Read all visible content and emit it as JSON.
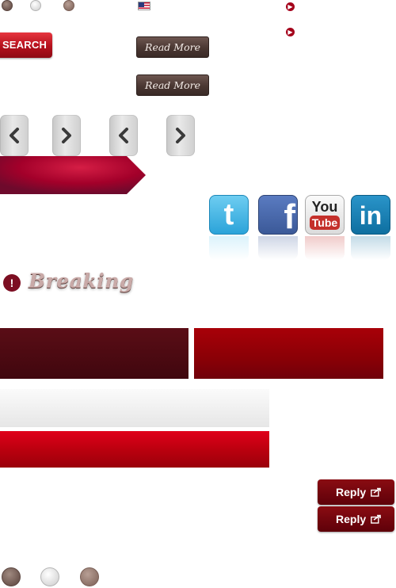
{
  "top_dots": [
    "brown-dot",
    "white-dot",
    "tan-dot"
  ],
  "flag": {
    "icon": "us-flag-icon"
  },
  "bullets": [
    "arrow-bullet-icon",
    "arrow-bullet-icon"
  ],
  "search": {
    "label": "SEARCH"
  },
  "read_more": [
    {
      "label": "Read More"
    },
    {
      "label": "Read More"
    }
  ],
  "nav_arrows": [
    "chevron-left-icon",
    "chevron-right-icon",
    "chevron-left-icon",
    "chevron-right-icon"
  ],
  "ribbon": {
    "colors": {
      "start": "#a3002a",
      "end": "#5e0a2a"
    }
  },
  "social": [
    {
      "name": "twitter",
      "text": "t",
      "color": "#3fb4e6"
    },
    {
      "name": "facebook",
      "text": "f",
      "color": "#3b5998"
    },
    {
      "name": "youtube",
      "text_top": "You",
      "text_bottom": "Tube",
      "color": "#c4302b"
    },
    {
      "name": "linkedin",
      "text": "in",
      "color": "#0e76a8"
    }
  ],
  "breaking": {
    "label": "Breaking",
    "icon": "exclamation-icon"
  },
  "colors": {
    "dark_red_panel": "#4e0a12",
    "red_panel": "#9b0006",
    "light_panel": "#efefef",
    "bright_red_panel": "#c80010",
    "accent": "#a4001a"
  },
  "reply": [
    {
      "label": "Reply"
    },
    {
      "label": "Reply"
    }
  ],
  "bottom_dots": [
    "brown-dot",
    "white-dot",
    "tan-dot"
  ]
}
